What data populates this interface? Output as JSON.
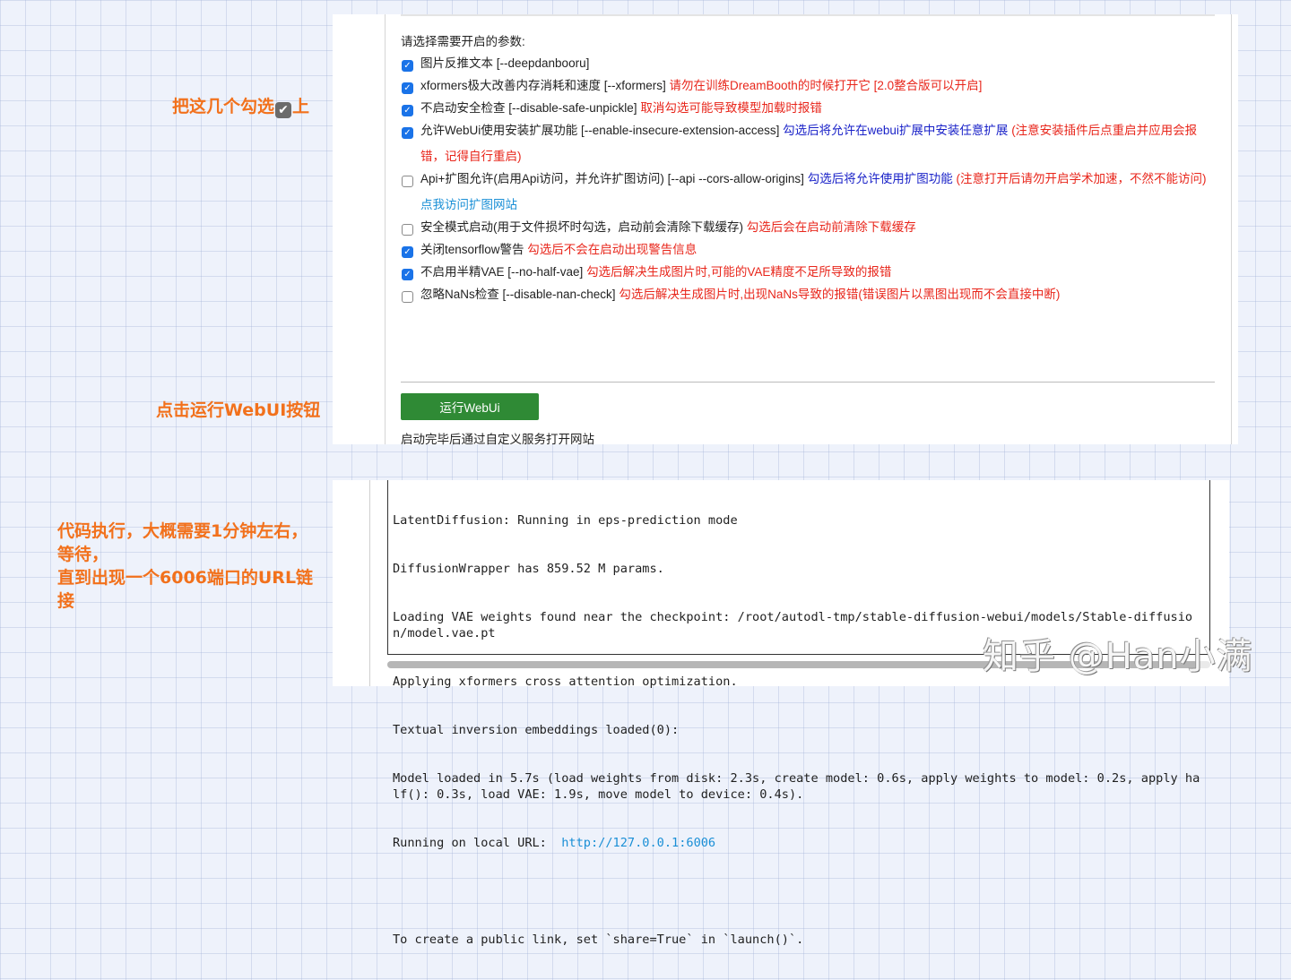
{
  "annotations": {
    "check": {
      "before": "把这几个勾选",
      "emoji": "✔",
      "after": "上"
    },
    "run": "点击运行WebUI按钮",
    "wait": [
      "代码执行，大概需要1分钟左右，",
      "等待，",
      "直到出现一个6006端口的URL链",
      "接"
    ]
  },
  "settings": {
    "prompt": "请选择需要开启的参数:",
    "options": [
      {
        "checked": true,
        "label": "图片反推文本 [--deepdanbooru]",
        "note_red": "",
        "note_blue": "",
        "note_red2": "",
        "link": ""
      },
      {
        "checked": true,
        "label": "xformers极大改善内存消耗和速度 [--xformers]",
        "note_red": "请勿在训练DreamBooth的时候打开它 [2.0整合版可以开启]",
        "note_blue": "",
        "note_red2": "",
        "link": ""
      },
      {
        "checked": true,
        "label": "不启动安全检查 [--disable-safe-unpickle]",
        "note_red": "取消勾选可能导致模型加载时报错",
        "note_blue": "",
        "note_red2": "",
        "link": ""
      },
      {
        "checked": true,
        "label": "允许WebUi使用安装扩展功能 [--enable-insecure-extension-access]",
        "note_red": "",
        "note_blue": "勾选后将允许在webui扩展中安装任意扩展",
        "note_red2": "(注意安装插件后点重启并应用会报错，记得自行重启)",
        "link": ""
      },
      {
        "checked": false,
        "label": "Api+扩图允许(启用Api访问，并允许扩图访问) [--api --cors-allow-origins]",
        "note_red": "",
        "note_blue": "勾选后将允许使用扩图功能",
        "note_red2": "(注意打开后请勿开启学术加速，不然不能访问)",
        "link": "点我访问扩图网站"
      },
      {
        "checked": false,
        "label": "安全模式启动(用于文件损坏时勾选，启动前会清除下载缓存)",
        "note_red": "勾选后会在启动前清除下载缓存",
        "note_blue": "",
        "note_red2": "",
        "link": ""
      },
      {
        "checked": true,
        "label": "关闭tensorflow警告",
        "note_red": "勾选后不会在启动出现警告信息",
        "note_blue": "",
        "note_red2": "",
        "link": ""
      },
      {
        "checked": true,
        "label": "不启用半精VAE [--no-half-vae]",
        "note_red": "勾选后解决生成图片时,可能的VAE精度不足所导致的报错",
        "note_blue": "",
        "note_red2": "",
        "link": ""
      },
      {
        "checked": false,
        "label": "忽略NaNs检查 [--disable-nan-check]",
        "note_red": "勾选后解决生成图片时,出现NaNs导致的报错(错误图片以黑图出现而不会直接中断)",
        "note_blue": "",
        "note_red2": "",
        "link": ""
      }
    ],
    "run_button": "运行WebUi",
    "after_text": "启动完毕后通过自定义服务打开网站"
  },
  "console": {
    "lines": [
      "LatentDiffusion: Running in eps-prediction mode",
      "DiffusionWrapper has 859.52 M params.",
      "Loading VAE weights found near the checkpoint: /root/autodl-tmp/stable-diffusion-webui/models/Stable-diffusion/model.vae.pt",
      "Applying xformers cross attention optimization.",
      "Textual inversion embeddings loaded(0):",
      "Model loaded in 5.7s (load weights from disk: 2.3s, create model: 0.6s, apply weights to model: 0.2s, apply half(): 0.3s, load VAE: 1.9s, move model to device: 0.4s)."
    ],
    "url_prefix": "Running on local URL:  ",
    "url": "http://127.0.0.1:6006",
    "share_line": "To create a public link, set `share=True` in `launch()`."
  },
  "watermark": "知乎 @Han小满"
}
